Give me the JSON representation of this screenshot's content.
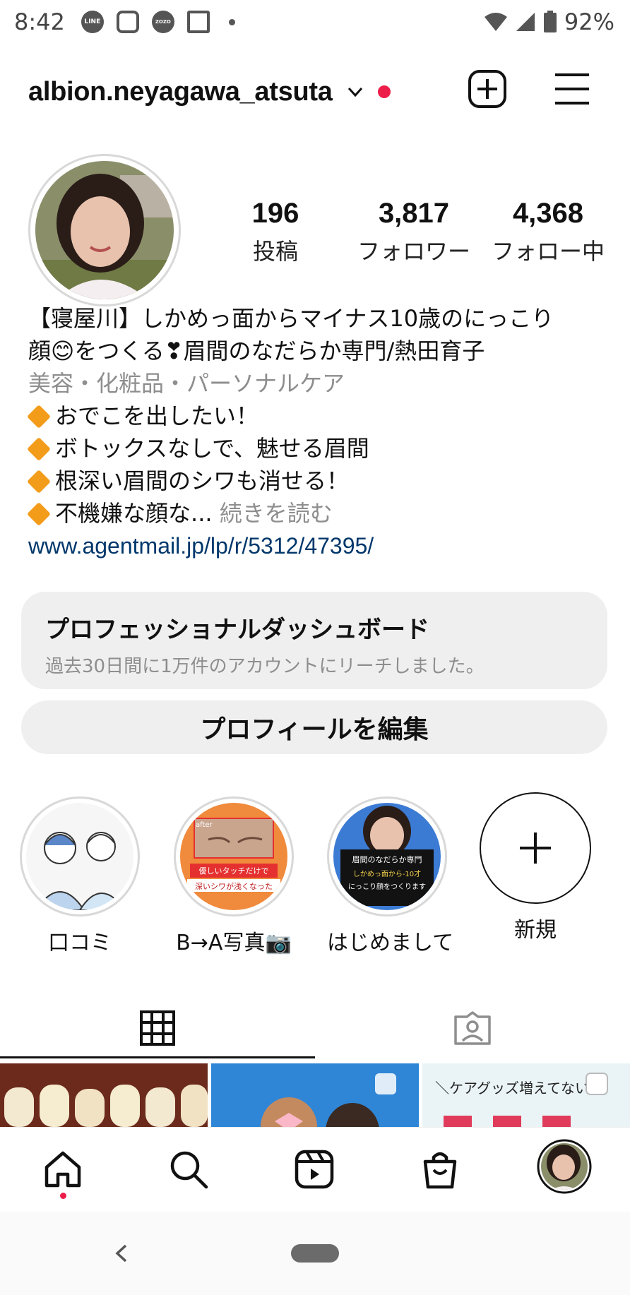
{
  "status_bar": {
    "time": "8:42",
    "app_icons": [
      "LINE",
      "instagram-icon",
      "ZOZO TOWN",
      "FamilyMart"
    ],
    "battery": "92%"
  },
  "header": {
    "username": "albion.neyagawa_atsuta",
    "icons": [
      "chevron-down-icon",
      "notification-dot",
      "new-post-icon",
      "menu-icon"
    ]
  },
  "profile": {
    "stats": [
      {
        "value": "196",
        "label": "投稿"
      },
      {
        "value": "3,817",
        "label": "フォロワー"
      },
      {
        "value": "4,368",
        "label": "フォロー中"
      }
    ],
    "bio": {
      "name_line1": "【寝屋川】しかめっ面からマイナス10歳のにっこり",
      "name_line2": "顔😊をつくる❣眉間のなだらか専門/熱田育子",
      "category": "美容・化粧品・パーソナルケア",
      "points": [
        "おでこを出したい！",
        "ボトックスなしで、魅せる眉間",
        "根深い眉間のシワも消せる！"
      ],
      "last_point": "不機嫌な顔な",
      "ellipsis": "...",
      "more": "続きを読む",
      "link": "www.agentmail.jp/lp/r/5312/47395/"
    }
  },
  "dashboard": {
    "title": "プロフェッショナルダッシュボード",
    "subtitle": "過去30日間に1万件のアカウントにリーチしました。"
  },
  "edit_profile_label": "プロフィールを編集",
  "highlights": [
    {
      "label": "口コミ"
    },
    {
      "label": "B→A写真📷"
    },
    {
      "label": "はじめまして"
    },
    {
      "label": "新規"
    }
  ],
  "highlight_art": {
    "after_tag": "after",
    "b2a_caption_1": "優しいタッチだけで",
    "b2a_caption_2": "深いシワが浅くなった",
    "intro_title": "眉間のなだらか専門",
    "intro_line1": "しかめっ面から-10才",
    "intro_line2": "にっこり顔をつくります"
  },
  "tabs": [
    "grid-icon",
    "tagged-icon"
  ],
  "grid_preview": {
    "post3_text": "＼ケアグッズ増えてない"
  },
  "bottom_nav": [
    "home-icon",
    "search-icon",
    "reels-icon",
    "shop-icon",
    "profile-avatar"
  ]
}
